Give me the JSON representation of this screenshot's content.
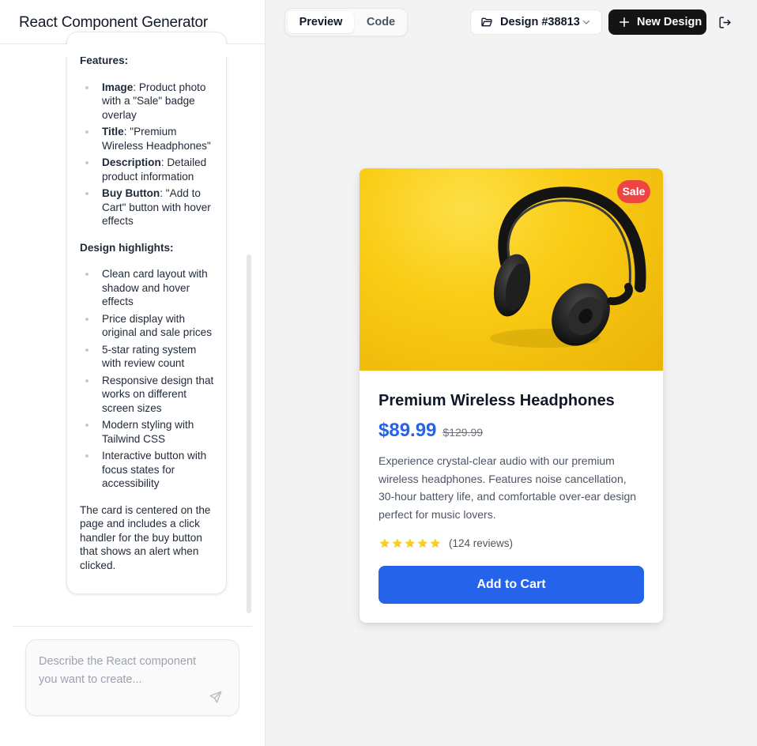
{
  "app": {
    "title": "React Component Generator"
  },
  "chat": {
    "features_heading": "Features:",
    "features": [
      {
        "label": "Image",
        "text": ": Product photo with a \"Sale\" badge overlay"
      },
      {
        "label": "Title",
        "text": ": \"Premium Wireless Headphones\""
      },
      {
        "label": "Description",
        "text": ": Detailed product information"
      },
      {
        "label": "Buy Button",
        "text": ": \"Add to Cart\" button with hover effects"
      }
    ],
    "highlights_heading": "Design highlights:",
    "highlights": [
      "Clean card layout with shadow and hover effects",
      "Price display with original and sale prices",
      "5-star rating system with review count",
      "Responsive design that works on different screen sizes",
      "Modern styling with Tailwind CSS",
      "Interactive button with focus states for accessibility"
    ],
    "closing": "The card is centered on the page and includes a click handler for the buy button that shows an alert when clicked."
  },
  "prompt": {
    "placeholder": "Describe the React component you want to create..."
  },
  "toolbar": {
    "tab_preview": "Preview",
    "tab_code": "Code",
    "active_tab": "Preview",
    "design_label": "Design #38813",
    "new_design_label": "New Design"
  },
  "product": {
    "badge": "Sale",
    "title": "Premium Wireless Headphones",
    "price": "$89.99",
    "original_price": "$129.99",
    "description": "Experience crystal-clear audio with our premium wireless headphones. Features noise cancellation, 30-hour battery life, and comfortable over-ear design perfect for music lovers.",
    "rating": 5,
    "reviews": "(124 reviews)",
    "cta": "Add to Cart"
  },
  "colors": {
    "accent": "#2563eb",
    "badge": "#ef4444",
    "star": "#facc15",
    "primary_button": "#141414"
  },
  "icons": [
    "folder-icon",
    "chevron-down-icon",
    "plus-icon",
    "logout-icon",
    "send-icon",
    "star-icon"
  ]
}
